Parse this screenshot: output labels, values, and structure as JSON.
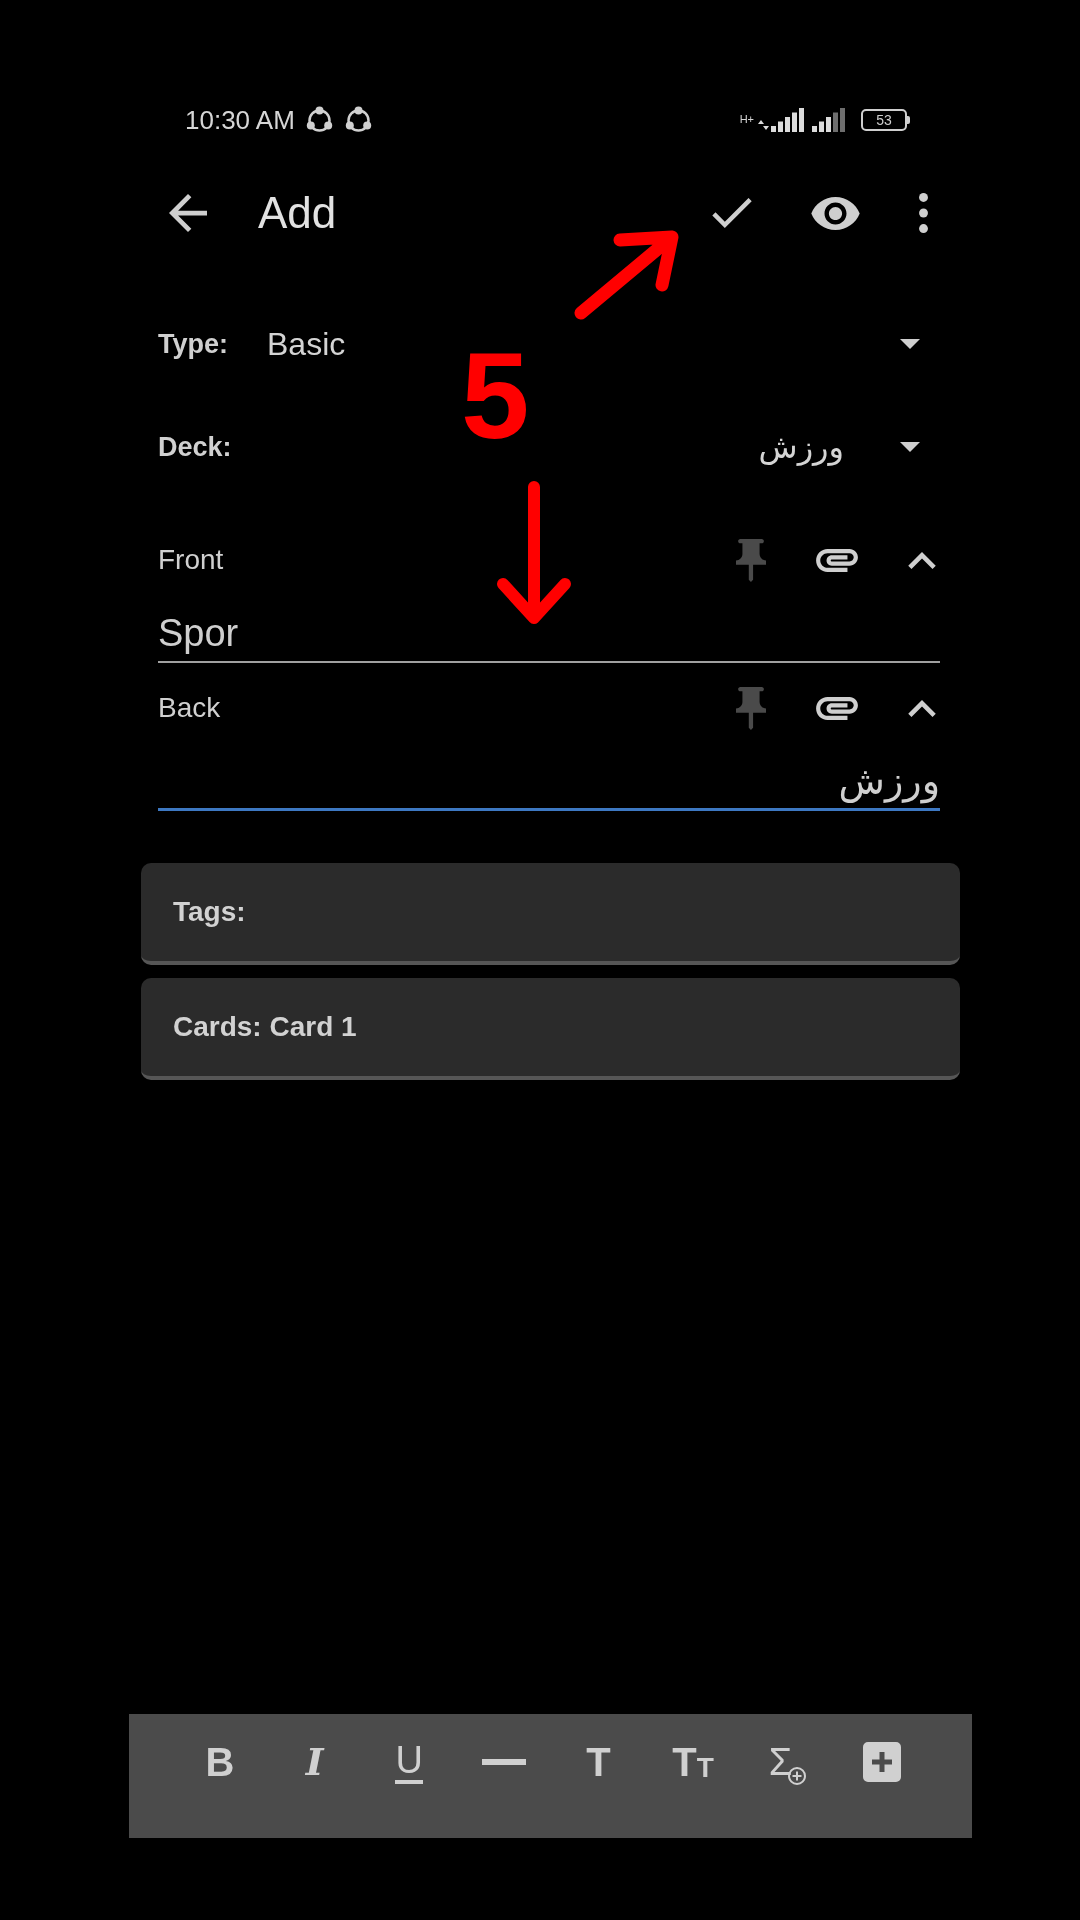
{
  "status_bar": {
    "time": "10:30 AM",
    "network_type": "H+",
    "battery": "53"
  },
  "app_bar": {
    "title": "Add"
  },
  "note_type": {
    "label": "Type:",
    "value": "Basic"
  },
  "deck": {
    "label": "Deck:",
    "value": "ورزش"
  },
  "fields": [
    {
      "label": "Front",
      "value": "Spor",
      "focused": false,
      "sticky": false
    },
    {
      "label": "Back",
      "value": "ورزش",
      "focused": true,
      "sticky": false
    }
  ],
  "tags": {
    "label": "Tags:"
  },
  "cards": {
    "label": "Cards: Card 1"
  },
  "toolbar": [
    {
      "kind": "bold",
      "glyph": "B"
    },
    {
      "kind": "italic",
      "glyph": "I"
    },
    {
      "kind": "underline",
      "glyph": "U"
    },
    {
      "kind": "rule"
    },
    {
      "kind": "heading",
      "glyph": "T"
    },
    {
      "kind": "size",
      "glyph": "T",
      "small_glyph": "T"
    },
    {
      "kind": "math",
      "glyph": "Σ"
    },
    {
      "kind": "add"
    }
  ],
  "annotation": {
    "step_number": "5"
  }
}
